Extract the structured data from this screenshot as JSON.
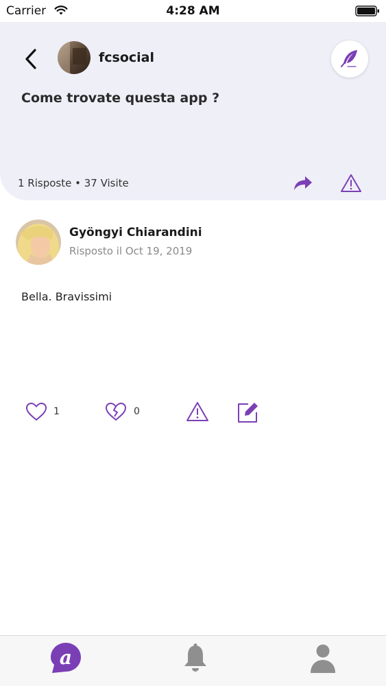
{
  "status_bar": {
    "carrier": "Carrier",
    "time": "4:28 AM"
  },
  "header": {
    "asker_name": "fcsocial",
    "question": "Come trovate questa app ?",
    "stats": "1 Risposte • 37 Visite"
  },
  "answer": {
    "author": "Gyöngyi Chiarandini",
    "date": "Risposto il Oct 19, 2019",
    "body": "Bella. Bravissimi",
    "likes": "1",
    "dislikes": "0"
  },
  "colors": {
    "accent": "#7b3fb5",
    "header_bg": "#efeff8",
    "icon_gray": "#8f8f8f"
  },
  "tabs": [
    {
      "icon": "app-logo-icon",
      "active": true
    },
    {
      "icon": "bell-icon",
      "active": false
    },
    {
      "icon": "user-icon",
      "active": false
    }
  ]
}
